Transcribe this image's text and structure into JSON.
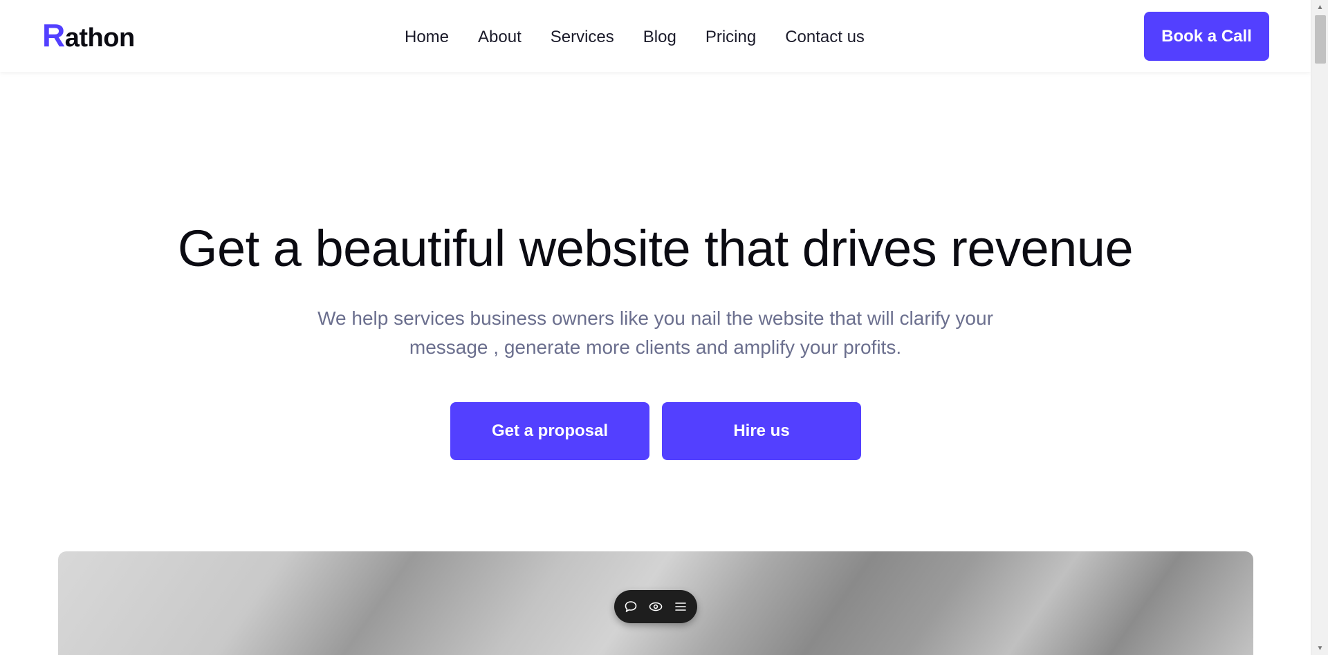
{
  "header": {
    "logo_accent": "R",
    "logo_rest": "athon",
    "nav": [
      "Home",
      "About",
      "Services",
      "Blog",
      "Pricing",
      "Contact us"
    ],
    "cta_label": "Book a Call"
  },
  "hero": {
    "title": "Get a beautiful website that drives revenue",
    "subtitle_line1": "We help services business owners like you nail the website that will clarify your",
    "subtitle_line2": "message , generate more clients and amplify your profits.",
    "buttons": [
      "Get a proposal",
      "Hire us"
    ]
  },
  "toolbar": {
    "icons": [
      "chat-bubble-icon",
      "eye-icon",
      "menu-icon"
    ]
  },
  "colors": {
    "accent": "#5340ff",
    "text": "#0b0b12",
    "muted": "#6b6f8e"
  }
}
